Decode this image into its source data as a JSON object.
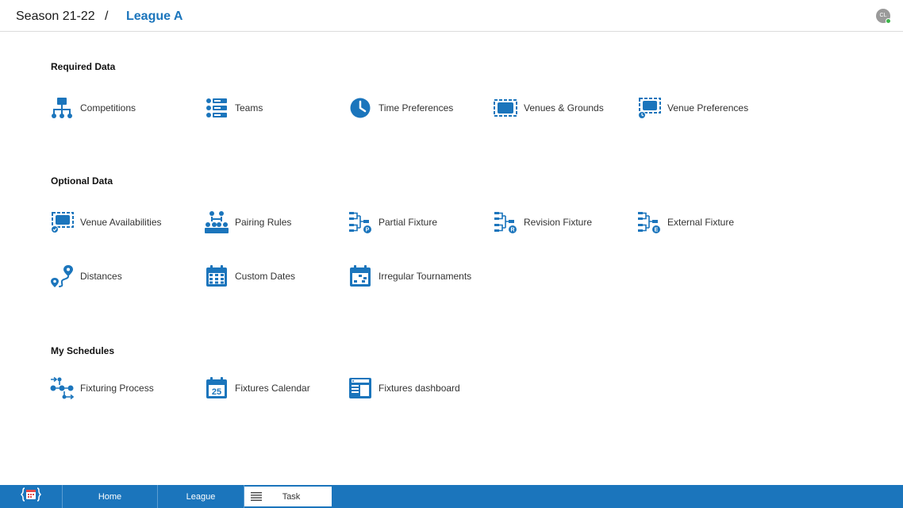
{
  "header": {
    "season": "Season 21-22",
    "separator": "/",
    "league": "League A",
    "avatar_initials": "CL"
  },
  "sections": {
    "required": {
      "title": "Required Data",
      "items": [
        {
          "label": "Competitions",
          "icon": "competitions-icon"
        },
        {
          "label": "Teams",
          "icon": "teams-icon"
        },
        {
          "label": "Time Preferences",
          "icon": "clock-icon"
        },
        {
          "label": "Venues & Grounds",
          "icon": "venue-icon"
        },
        {
          "label": "Venue Preferences",
          "icon": "venue-clock-icon"
        }
      ]
    },
    "optional": {
      "title": "Optional Data",
      "items": [
        {
          "label": "Venue Availabilities",
          "icon": "venue-check-icon"
        },
        {
          "label": "Pairing Rules",
          "icon": "pairing-icon"
        },
        {
          "label": "Partial Fixture",
          "icon": "fixture-p-icon",
          "badge": "P"
        },
        {
          "label": "Revision Fixture",
          "icon": "fixture-r-icon",
          "badge": "R"
        },
        {
          "label": "External Fixture",
          "icon": "fixture-e-icon",
          "badge": "E"
        },
        {
          "label": "Distances",
          "icon": "route-icon"
        },
        {
          "label": "Custom Dates",
          "icon": "calendar-grid-icon"
        },
        {
          "label": "Irregular Tournaments",
          "icon": "calendar-irregular-icon"
        }
      ]
    },
    "schedules": {
      "title": "My Schedules",
      "items": [
        {
          "label": "Fixturing Process",
          "icon": "process-icon"
        },
        {
          "label": "Fixtures Calendar",
          "icon": "calendar-25-icon",
          "badge": "25"
        },
        {
          "label": "Fixtures dashboard",
          "icon": "dashboard-icon"
        }
      ]
    }
  },
  "footer": {
    "tabs": [
      "Home",
      "League",
      "Task"
    ]
  },
  "colors": {
    "accent": "#1b75bc",
    "footer": "#1b75bc",
    "online": "#3cb54a"
  }
}
